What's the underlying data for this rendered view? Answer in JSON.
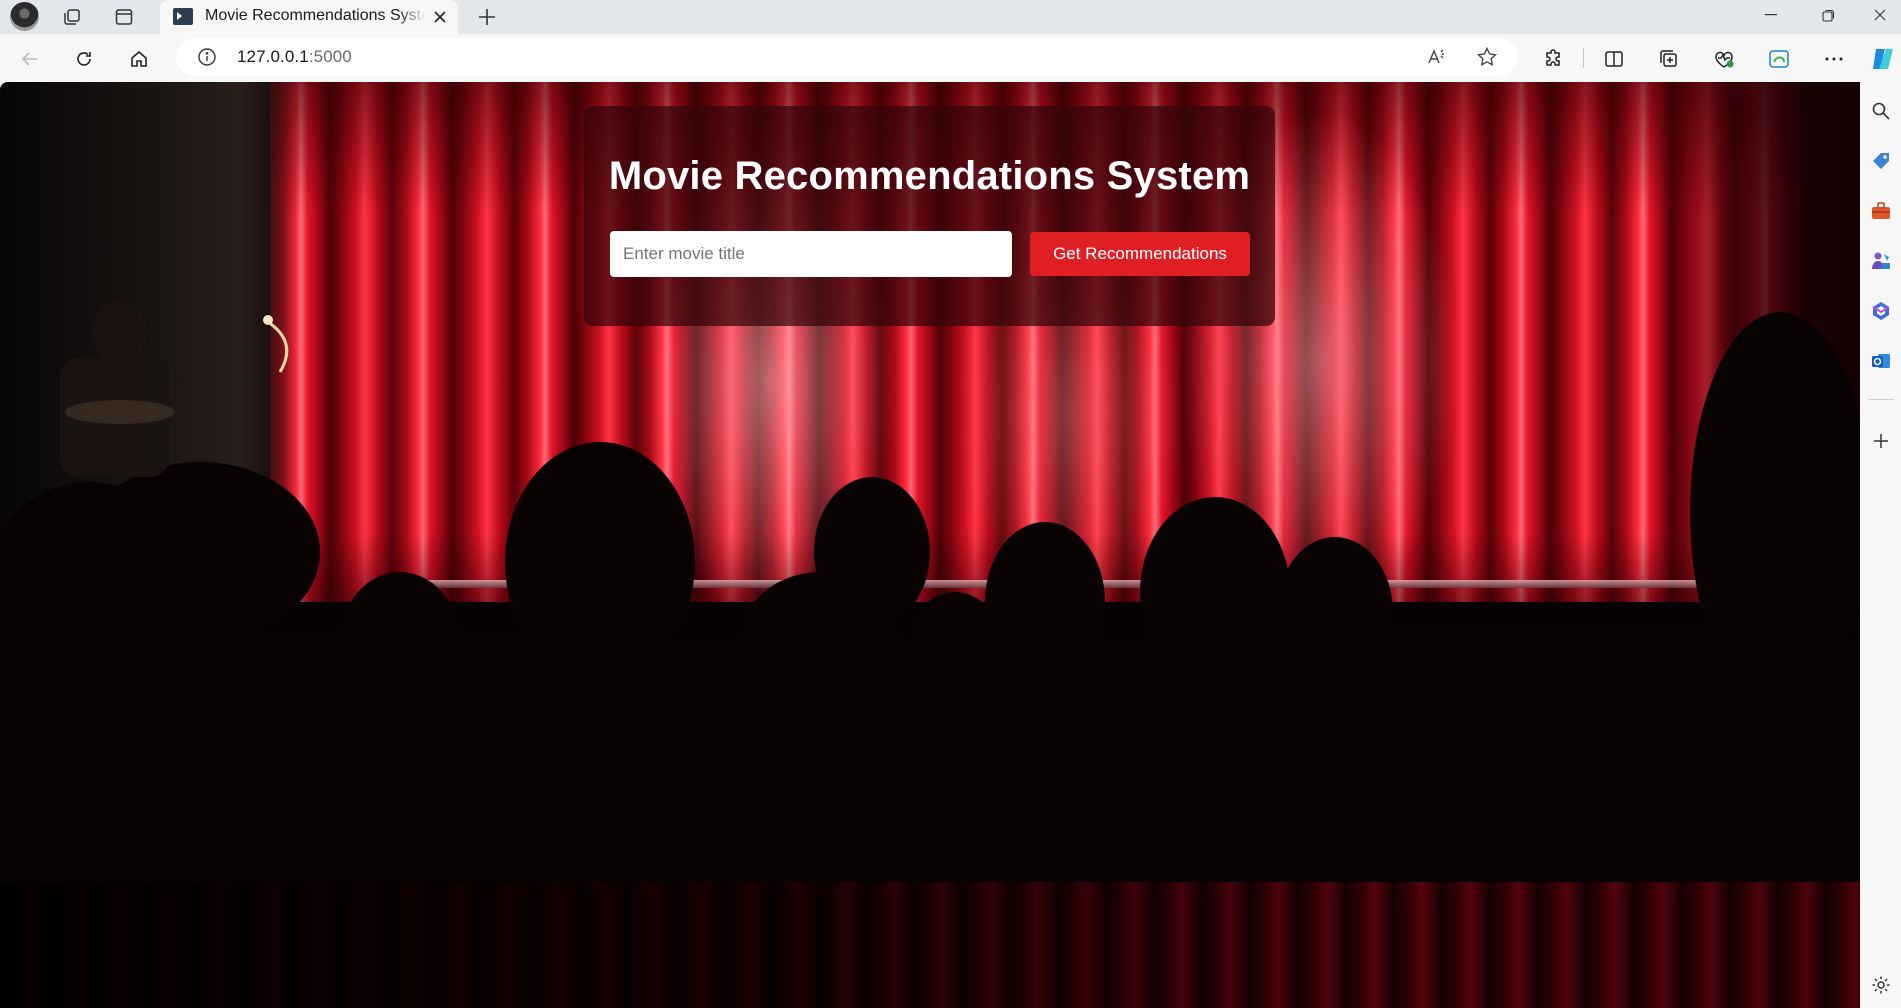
{
  "browser": {
    "tab": {
      "title": "Movie Recommendations System"
    },
    "address_bar": {
      "host": "127.0.0.1",
      "port": ":5000"
    },
    "toolbar_icons": [
      "back-icon",
      "refresh-icon",
      "home-icon",
      "info-icon",
      "read-aloud-icon",
      "favorite-star-icon",
      "extensions-icon",
      "split-screen-icon",
      "collections-icon",
      "browser-essentials-icon",
      "edge-icon",
      "more-icon",
      "copilot-icon"
    ],
    "sidebar_icons": [
      "search-icon",
      "shopping-tag-icon",
      "tools-icon",
      "games-icon",
      "microsoft365-icon",
      "outlook-icon",
      "add-icon",
      "settings-icon"
    ]
  },
  "page": {
    "heading": "Movie Recommendations System",
    "search": {
      "placeholder": "Enter movie title",
      "value": ""
    },
    "button_label": "Get Recommendations"
  },
  "colors": {
    "accent_button": "#e01f24",
    "card_overlay": "rgba(50, 6, 10, 0.72)",
    "curtain_red": "#d01222"
  }
}
